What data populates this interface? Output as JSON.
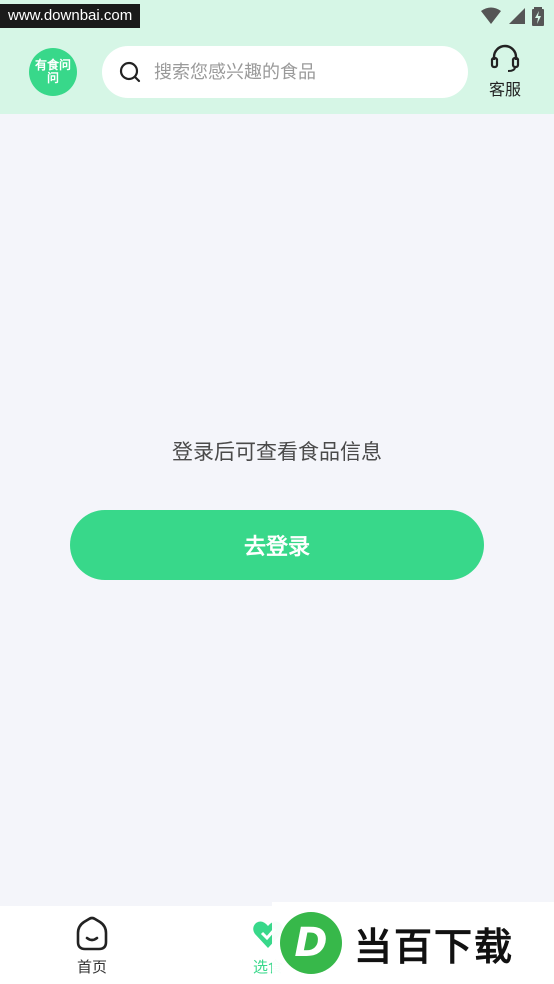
{
  "status_bar": {
    "watermark": "www.downbai.com"
  },
  "header": {
    "logo_text": "有食问问",
    "search_placeholder": "搜索您感兴趣的食品",
    "service_label": "客服"
  },
  "main": {
    "hint": "登录后可查看食品信息",
    "login_button": "去登录"
  },
  "tabbar": {
    "tabs": [
      {
        "label": "首页",
        "icon": "home-icon",
        "active": false
      },
      {
        "label": "选食",
        "icon": "heart-check-icon",
        "active": true
      }
    ]
  },
  "watermark": {
    "brand": "当百下载",
    "letter": "D"
  },
  "colors": {
    "accent": "#38d88a",
    "header_bg": "#d6f6e6",
    "page_bg": "#f4f5fa"
  }
}
